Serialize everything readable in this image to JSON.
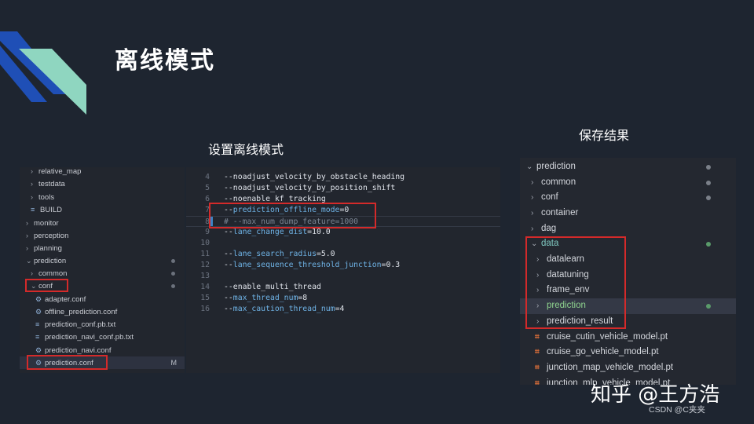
{
  "slide": {
    "title": "离线模式",
    "caption_left": "设置离线模式",
    "caption_right": "保存结果"
  },
  "colors": {
    "background": "#1e2530",
    "accent_blue": "#1f4fb6",
    "accent_teal": "#8fd6c0",
    "highlight_red": "#d42a2a"
  },
  "left_explorer": {
    "items": [
      {
        "label": "relative_map",
        "type": "folder",
        "expanded": false
      },
      {
        "label": "testdata",
        "type": "folder",
        "expanded": false
      },
      {
        "label": "tools",
        "type": "folder",
        "expanded": false
      },
      {
        "label": "BUILD",
        "type": "file",
        "icon": "build-file-icon"
      },
      {
        "label": "monitor",
        "type": "folder",
        "expanded": false
      },
      {
        "label": "perception",
        "type": "folder",
        "expanded": false
      },
      {
        "label": "planning",
        "type": "folder",
        "expanded": false
      },
      {
        "label": "prediction",
        "type": "folder",
        "expanded": true
      },
      {
        "label": "common",
        "type": "folder",
        "expanded": false
      },
      {
        "label": "conf",
        "type": "folder",
        "expanded": true
      },
      {
        "label": "adapter.conf",
        "type": "file",
        "icon": "gear-icon"
      },
      {
        "label": "offline_prediction.conf",
        "type": "file",
        "icon": "gear-icon"
      },
      {
        "label": "prediction_conf.pb.txt",
        "type": "file",
        "icon": "text-file-icon"
      },
      {
        "label": "prediction_navi_conf.pb.txt",
        "type": "file",
        "icon": "text-file-icon"
      },
      {
        "label": "prediction_navi.conf",
        "type": "file",
        "icon": "gear-icon"
      },
      {
        "label": "prediction.conf",
        "type": "file",
        "icon": "gear-icon",
        "badge": "M"
      }
    ]
  },
  "code_editor": {
    "lines": [
      {
        "num": "4",
        "text": "--noadjust_velocity_by_obstacle_heading",
        "kind": "plain"
      },
      {
        "num": "5",
        "text": "--noadjust_velocity_by_position_shift",
        "kind": "plain"
      },
      {
        "num": "6",
        "text": "--noenable_kf_tracking",
        "kind": "plain"
      },
      {
        "num": "7",
        "prefix": "--",
        "param": "prediction_offline_mode",
        "value": "=0",
        "kind": "param"
      },
      {
        "num": "8",
        "text": "# --max_num_dump_feature=1000",
        "kind": "comment"
      },
      {
        "num": "9",
        "prefix": "--",
        "param": "lane_change_dist",
        "value": "=10.0",
        "kind": "param"
      },
      {
        "num": "10",
        "text": "",
        "kind": "plain"
      },
      {
        "num": "11",
        "prefix": "--",
        "param": "lane_search_radius",
        "value": "=5.0",
        "kind": "param"
      },
      {
        "num": "12",
        "prefix": "--",
        "param": "lane_sequence_threshold_junction",
        "value": "=0.3",
        "kind": "param"
      },
      {
        "num": "13",
        "text": "",
        "kind": "plain"
      },
      {
        "num": "14",
        "text": "--enable_multi_thread",
        "kind": "plain"
      },
      {
        "num": "15",
        "prefix": "--",
        "param": "max_thread_num",
        "value": "=8",
        "kind": "param"
      },
      {
        "num": "16",
        "prefix": "--",
        "param": "max_caution_thread_num",
        "value": "=4",
        "kind": "param"
      }
    ]
  },
  "right_explorer": {
    "items": [
      {
        "label": "prediction",
        "type": "folder",
        "expanded": true,
        "dot": "grey"
      },
      {
        "label": "common",
        "type": "folder",
        "expanded": false,
        "dot": "grey"
      },
      {
        "label": "conf",
        "type": "folder",
        "expanded": false,
        "dot": "grey"
      },
      {
        "label": "container",
        "type": "folder",
        "expanded": false
      },
      {
        "label": "dag",
        "type": "folder",
        "expanded": false
      },
      {
        "label": "data",
        "type": "folder",
        "expanded": true,
        "dot": "green"
      },
      {
        "label": "datalearn",
        "type": "folder",
        "expanded": false
      },
      {
        "label": "datatuning",
        "type": "folder",
        "expanded": false
      },
      {
        "label": "frame_env",
        "type": "folder",
        "expanded": false
      },
      {
        "label": "prediction",
        "type": "folder",
        "expanded": false,
        "dot": "green"
      },
      {
        "label": "prediction_result",
        "type": "folder",
        "expanded": false
      },
      {
        "label": "cruise_cutin_vehicle_model.pt",
        "type": "file",
        "icon": "rss-file-icon"
      },
      {
        "label": "cruise_go_vehicle_model.pt",
        "type": "file",
        "icon": "rss-file-icon"
      },
      {
        "label": "junction_map_vehicle_model.pt",
        "type": "file",
        "icon": "rss-file-icon"
      },
      {
        "label": "junction_mlp_vehicle_model.pt",
        "type": "file",
        "icon": "rss-file-icon"
      }
    ]
  },
  "watermarks": {
    "zhihu": "知乎 @王方浩",
    "csdn": "CSDN @C夹夹"
  }
}
